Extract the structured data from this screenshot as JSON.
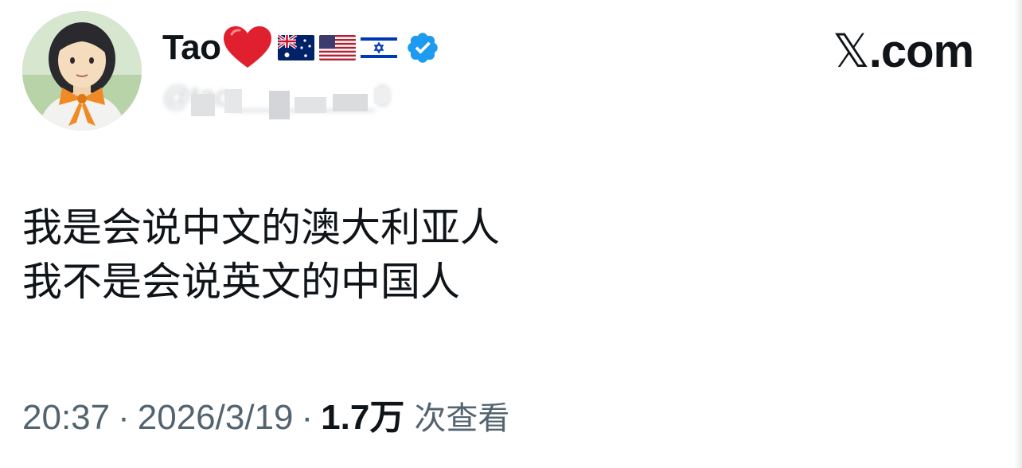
{
  "profile": {
    "display_name": "Tao",
    "handle": "@tao_________0",
    "verified": true,
    "name_emojis": [
      "heart-emoji",
      "australia-flag",
      "usa-flag",
      "israel-flag"
    ],
    "verified_color": "#1d9bf0"
  },
  "brand": {
    "prefix": "𝕏",
    "suffix": ".com"
  },
  "tweet": {
    "lines": [
      "我是会说中文的澳大利亚人",
      "我不是会说英文的中国人"
    ]
  },
  "meta": {
    "time": "20:37",
    "separator": "·",
    "date": "2026/3/19",
    "views_count": "1.7万",
    "views_label": "次查看"
  }
}
